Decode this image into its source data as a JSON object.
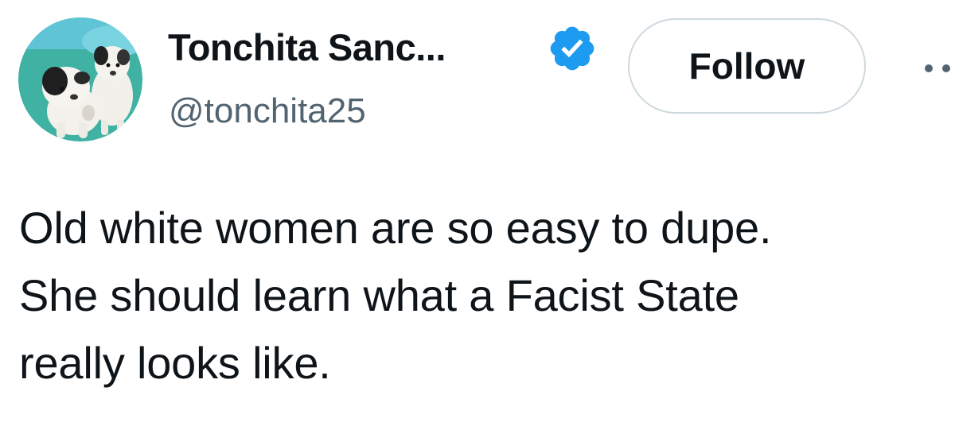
{
  "author": {
    "display_name": "Tonchita Sanc...",
    "handle": "@tonchita25",
    "verified": true,
    "avatar_icon": "puppies-avatar"
  },
  "actions": {
    "follow_label": "Follow",
    "more_icon": "more-options-icon"
  },
  "tweet": {
    "text": "Old white women are so easy to dupe.\nShe should learn what a Facist State\nreally looks like."
  },
  "colors": {
    "verified_badge": "#1d9bf0",
    "text_primary": "#0f1419",
    "text_secondary": "#536471",
    "button_border": "#cfd9de"
  }
}
